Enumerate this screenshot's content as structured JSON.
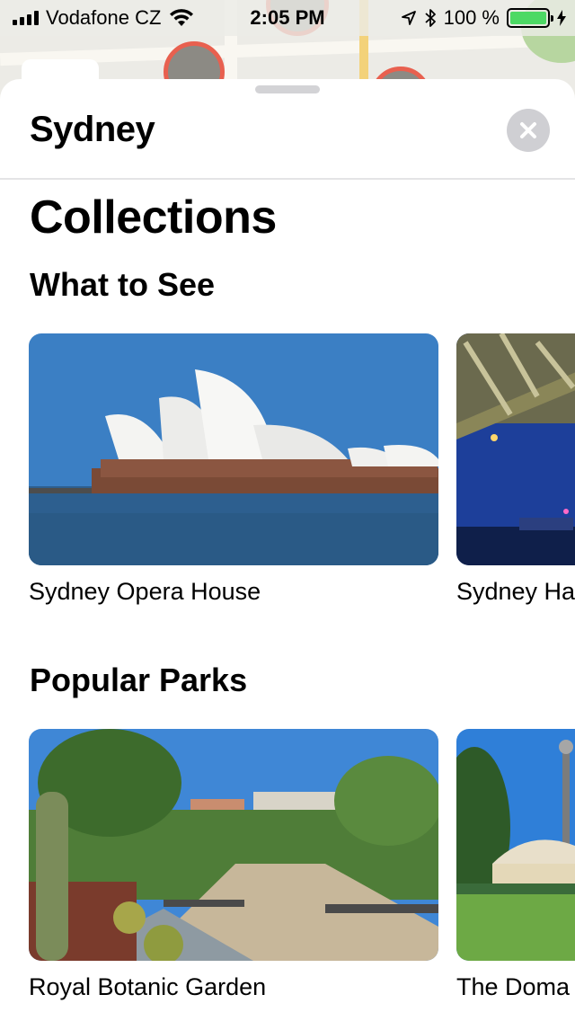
{
  "status_bar": {
    "carrier": "Vodafone CZ",
    "time": "2:05 PM",
    "battery_percent": "100 %",
    "battery_level": 1.0
  },
  "sheet": {
    "title": "Sydney",
    "close_icon": "close-icon"
  },
  "main": {
    "heading": "Collections",
    "sections": [
      {
        "title": "What to See",
        "items": [
          {
            "label": "Sydney Opera House",
            "image": "opera-house-photo"
          },
          {
            "label": "Sydney Ha",
            "image": "harbour-bridge-photo"
          }
        ]
      },
      {
        "title": "Popular Parks",
        "items": [
          {
            "label": "Royal Botanic Garden",
            "image": "botanic-garden-photo"
          },
          {
            "label": "The Doma",
            "image": "the-domain-photo"
          }
        ]
      }
    ]
  },
  "colors": {
    "accent_battery": "#4cd964",
    "map_pin": "#e8604f",
    "close_button_bg": "#cfcfd3"
  }
}
